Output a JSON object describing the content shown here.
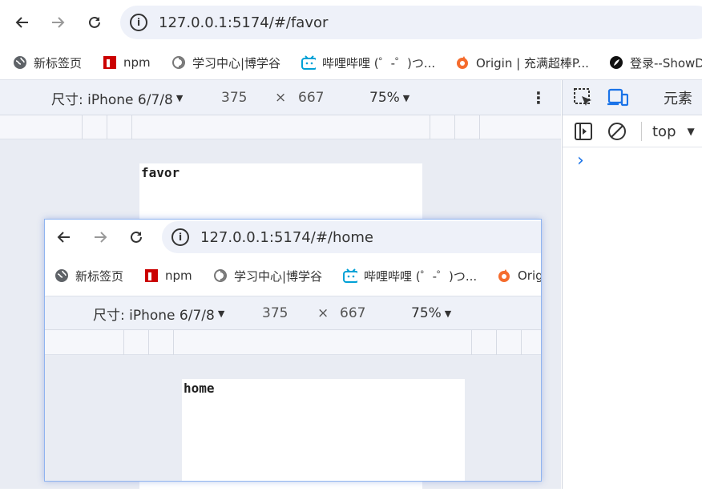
{
  "main": {
    "url": "127.0.0.1:5174/#/favor",
    "bookmarks": [
      {
        "label": "新标签页",
        "icon": "globe-icon"
      },
      {
        "label": "npm",
        "icon": "npm-icon"
      },
      {
        "label": "学习中心|博学谷",
        "icon": "swirl-icon"
      },
      {
        "label": "哔哩哔哩 (゜-゜)つ...",
        "icon": "bilibili-icon"
      },
      {
        "label": "Origin | 充满超棒P...",
        "icon": "origin-icon"
      },
      {
        "label": "登录--ShowD",
        "icon": "leaf-icon"
      }
    ],
    "device": {
      "label": "尺寸: iPhone 6/7/8",
      "width": "375",
      "times": "×",
      "height": "667",
      "zoom": "75%"
    },
    "page_text": "favor"
  },
  "devtools": {
    "tab_label": "元素",
    "context": "top",
    "prompt": "›"
  },
  "popup": {
    "url": "127.0.0.1:5174/#/home",
    "bookmarks": [
      {
        "label": "新标签页",
        "icon": "globe-icon"
      },
      {
        "label": "npm",
        "icon": "npm-icon"
      },
      {
        "label": "学习中心|博学谷",
        "icon": "swirl-icon"
      },
      {
        "label": "哔哩哔哩 (゜-゜)つ...",
        "icon": "bilibili-icon"
      },
      {
        "label": "Orig",
        "icon": "origin-icon"
      }
    ],
    "device": {
      "label": "尺寸: iPhone 6/7/8",
      "width": "375",
      "times": "×",
      "height": "667",
      "zoom": "75%"
    },
    "page_text": "home"
  },
  "colors": {
    "accent": "#1a73e8",
    "npm": "#cb0000",
    "bilibili": "#00a1d6",
    "origin": "#f56c2d"
  }
}
